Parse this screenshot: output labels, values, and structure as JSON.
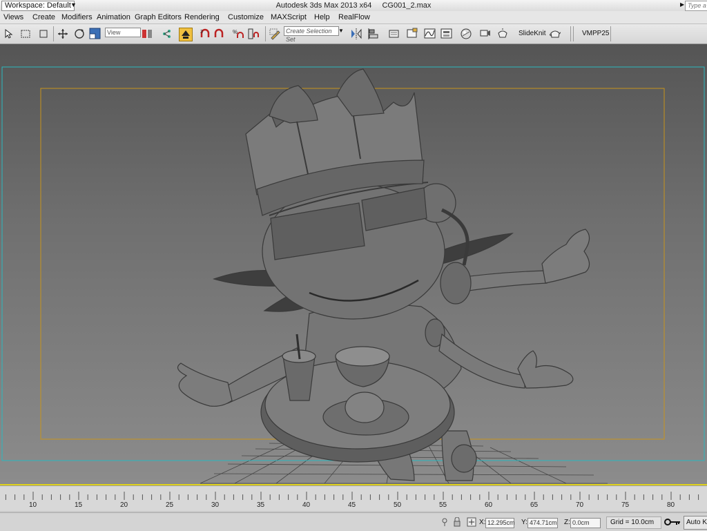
{
  "titlebar": {
    "workspace": "Workspace: Default",
    "app_title": "Autodesk 3ds Max  2013 x64",
    "file_name": "CG001_2.max",
    "search_placeholder": "Type a"
  },
  "menu": [
    "Views",
    "Create",
    "Modifiers",
    "Animation",
    "Graph Editors",
    "Rendering",
    "Customize",
    "MAXScript",
    "Help",
    "RealFlow"
  ],
  "toolbar": {
    "reference_coord": "View",
    "selection_set_placeholder": "Create Selection Set",
    "slideknit_label": "SlideKnit",
    "vmpp_label": "VMPP25"
  },
  "timeline": {
    "ticks": [
      "10",
      "15",
      "20",
      "25",
      "30",
      "35",
      "40",
      "45",
      "50",
      "55",
      "60",
      "65",
      "70",
      "75",
      "80"
    ]
  },
  "status": {
    "x_label": "X:",
    "x_value": "12.295cm",
    "y_label": "Y:",
    "y_value": "474.71cm",
    "z_label": "Z:",
    "z_value": "0.0cm",
    "grid": "Grid = 10.0cm",
    "autokey": "Auto Ke"
  },
  "colors": {
    "safe_frame_outer": "#29b9c0",
    "safe_frame_inner": "#c8941a",
    "active_border": "#e0d21a"
  }
}
